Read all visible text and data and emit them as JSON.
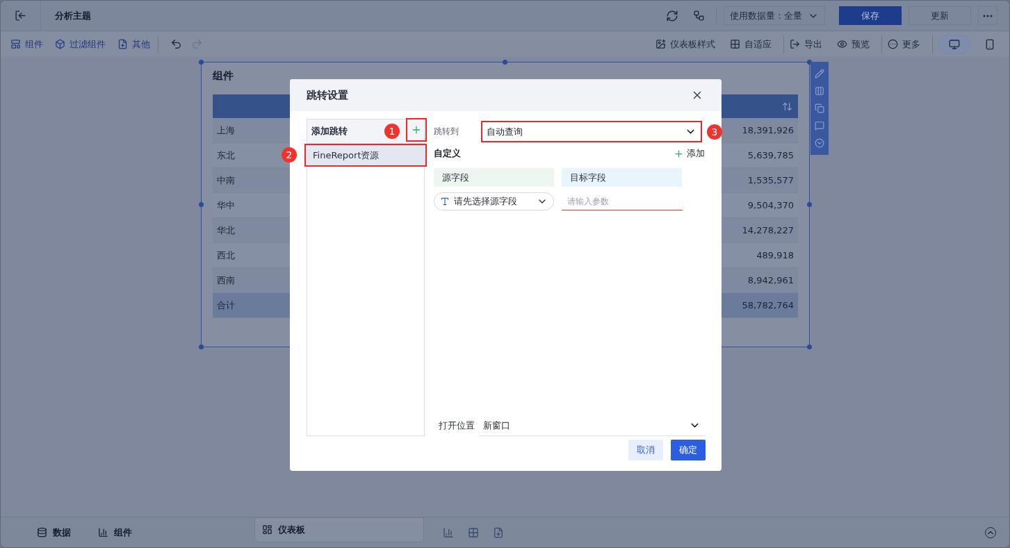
{
  "header": {
    "title": "分析主题",
    "data_amount": "使用数据量：全量",
    "buttons": [
      {
        "label": "保存",
        "kind": "primary"
      },
      {
        "label": "更新",
        "kind": "secondary"
      }
    ]
  },
  "toolbar": {
    "left": [
      {
        "label": "组件",
        "kind": "component"
      },
      {
        "label": "过滤组件",
        "kind": "filter"
      },
      {
        "label": "其他",
        "kind": "other"
      }
    ],
    "right": [
      {
        "label": "仪表板样式",
        "kind": "style"
      },
      {
        "label": "自适应",
        "kind": "fit"
      },
      {
        "label": "导出",
        "kind": "export"
      },
      {
        "label": "预览",
        "kind": "preview"
      },
      {
        "label": "更多",
        "kind": "more"
      }
    ],
    "devices": [
      {
        "kind": "desktop",
        "selected": true
      },
      {
        "kind": "mobile",
        "selected": false
      }
    ]
  },
  "widget": {
    "title": "组件",
    "rows": [
      {
        "region": "上海",
        "value": "18,391,926",
        "kind": "row"
      },
      {
        "region": "东北",
        "value": "5,639,785",
        "kind": "row"
      },
      {
        "region": "中南",
        "value": "1,535,577",
        "kind": "row"
      },
      {
        "region": "华中",
        "value": "9,504,370",
        "kind": "row"
      },
      {
        "region": "华北",
        "value": "14,278,227",
        "kind": "row"
      },
      {
        "region": "西北",
        "value": "489,918",
        "kind": "row"
      },
      {
        "region": "西南",
        "value": "8,942,961",
        "kind": "row"
      },
      {
        "region": "合计",
        "value": "58,782,764",
        "kind": "total"
      }
    ]
  },
  "dialog": {
    "title": "跳转设置",
    "list_title": "添加跳转",
    "add_callout": "1",
    "items": [
      {
        "label": "FineReport资源",
        "selected": true,
        "callout": "2"
      }
    ],
    "jump_to": {
      "label": "跳转到",
      "value": "自动查询",
      "callout": "3"
    },
    "custom_label": "自定义",
    "add_label": "添加",
    "columns": [
      {
        "label": "源字段",
        "kind": "source"
      },
      {
        "label": "目标字段",
        "kind": "target"
      }
    ],
    "source_select": {
      "placeholder": "请先选择源字段"
    },
    "target_input": {
      "placeholder": "请输入参数"
    },
    "open_position": {
      "label": "打开位置",
      "value": "新窗口"
    },
    "buttons": [
      {
        "label": "取消",
        "kind": "secondary"
      },
      {
        "label": "确定",
        "kind": "primary"
      }
    ]
  },
  "bottom_bar": {
    "tabs": [
      {
        "label": "数据",
        "kind": "data",
        "selected": false
      },
      {
        "label": "组件",
        "kind": "chart",
        "selected": false
      },
      {
        "label": "仪表板",
        "kind": "dashboard",
        "selected": true
      }
    ]
  }
}
